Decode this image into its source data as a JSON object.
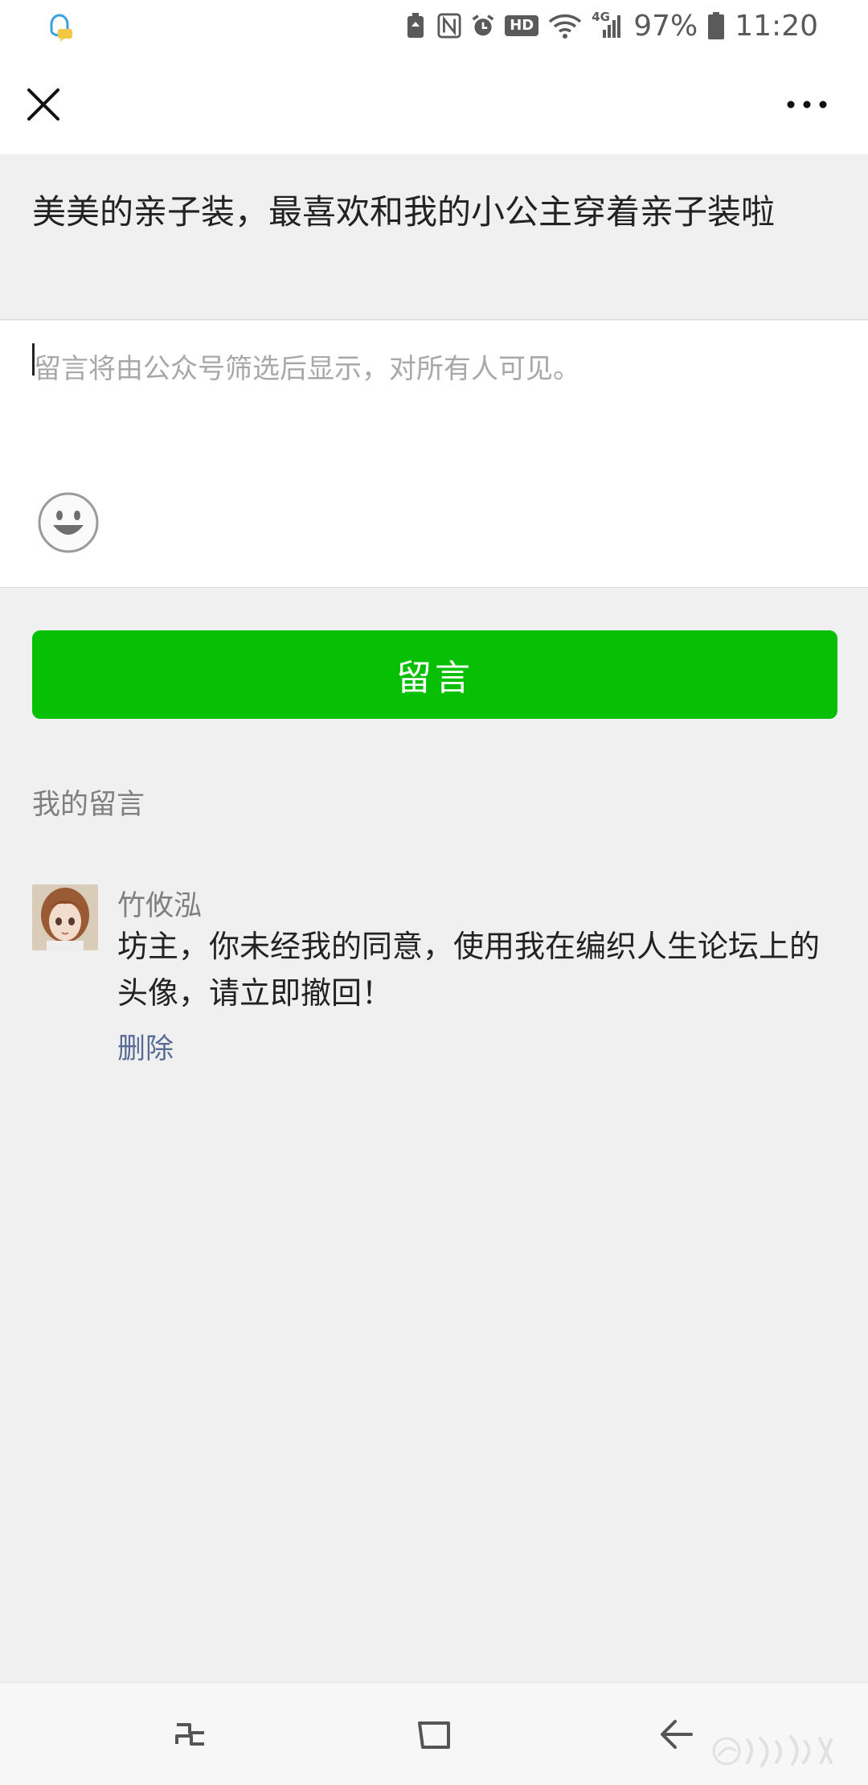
{
  "status_bar": {
    "battery_percent": "97%",
    "time": "11:20",
    "hd_label": "HD",
    "network_label": "4G",
    "icons": [
      "qq-notification-icon",
      "battery-saver-icon",
      "nfc-icon",
      "alarm-icon",
      "hd-voice-icon",
      "wifi-icon",
      "signal-icon",
      "battery-icon"
    ]
  },
  "top_bar": {
    "icons": [
      "close-icon",
      "more-icon"
    ]
  },
  "article": {
    "title": "美美的亲子装，最喜欢和我的小公主穿着亲子装啦"
  },
  "editor": {
    "placeholder": "留言将由公众号筛选后显示，对所有人可见。",
    "icons": [
      "emoji-icon"
    ]
  },
  "submit": {
    "label": "留言",
    "color": "#07c005"
  },
  "my_comments": {
    "section_title": "我的留言",
    "items": [
      {
        "author": "竹攸泓",
        "text": "坊主，你未经我的同意，使用我在编织人生论坛上的头像，请立即撤回！",
        "delete_label": "删除"
      }
    ]
  },
  "nav_bar": {
    "icons": [
      "recent-apps-icon",
      "home-icon",
      "back-icon"
    ]
  },
  "colors": {
    "accent_green": "#07c005",
    "link_blue": "#576b95",
    "background": "#f0f0f0"
  }
}
